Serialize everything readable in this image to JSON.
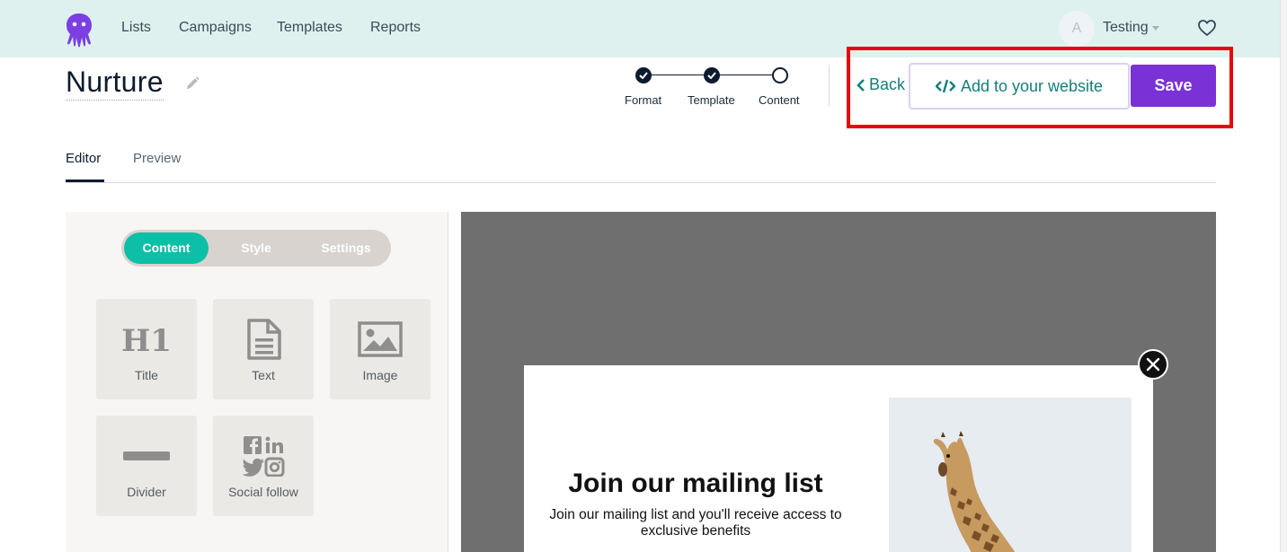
{
  "nav": {
    "links": [
      "Lists",
      "Campaigns",
      "Templates",
      "Reports"
    ],
    "user_initial": "A",
    "user_name": "Testing"
  },
  "page": {
    "title": "Nurture"
  },
  "stepper": {
    "steps": [
      {
        "label": "Format",
        "done": true
      },
      {
        "label": "Template",
        "done": true
      },
      {
        "label": "Content",
        "done": false
      }
    ]
  },
  "actions": {
    "back_label": "Back",
    "embed_label": "Add to your website",
    "save_label": "Save"
  },
  "tabs": [
    "Editor",
    "Preview"
  ],
  "panel": {
    "segments": [
      "Content",
      "Style",
      "Settings"
    ],
    "active_segment": "Content",
    "blocks": [
      {
        "label": "Title",
        "icon": "h1-icon"
      },
      {
        "label": "Text",
        "icon": "document-icon"
      },
      {
        "label": "Image",
        "icon": "image-icon"
      },
      {
        "label": "Divider",
        "icon": "divider-icon"
      },
      {
        "label": "Social follow",
        "icon": "social-icon"
      }
    ]
  },
  "popup": {
    "title": "Join our mailing list",
    "subtitle": "Join our mailing list and you'll receive access to exclusive benefits"
  },
  "colors": {
    "nav_bg": "#dff1ee",
    "accent_teal": "#0dbfa6",
    "link_teal": "#147f7a",
    "save_purple": "#7a31d6",
    "highlight_red": "#e8000b"
  }
}
